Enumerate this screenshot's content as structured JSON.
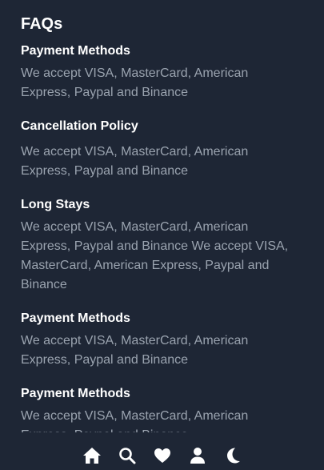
{
  "page": {
    "title": "FAQs"
  },
  "faqs": [
    {
      "title": "Payment Methods",
      "text": "We accept VISA, MasterCard, American Express, Paypal and Binance"
    },
    {
      "title": "Cancellation Policy",
      "text": "We accept VISA, MasterCard, American Express, Paypal and Binance"
    },
    {
      "title": "Long Stays",
      "text": "We accept VISA, MasterCard, American Express, Paypal and Binance We accept VISA, MasterCard, American Express, Paypal and Binance"
    },
    {
      "title": "Payment Methods",
      "text": "We accept VISA, MasterCard, American Express, Paypal and Binance"
    },
    {
      "title": "Payment Methods",
      "text": "We accept VISA, MasterCard, American Express, Paypal and Binance"
    }
  ],
  "tabbar": {
    "items": [
      {
        "icon": "home-icon"
      },
      {
        "icon": "search-icon"
      },
      {
        "icon": "heart-icon"
      },
      {
        "icon": "user-icon"
      },
      {
        "icon": "moon-icon"
      }
    ]
  },
  "colors": {
    "background": "#1e2635",
    "heading": "#ffffff",
    "body_text": "#9aa3af",
    "icon": "#ffffff"
  }
}
